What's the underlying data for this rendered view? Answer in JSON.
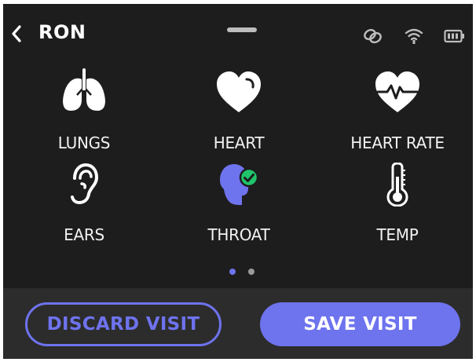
{
  "header": {
    "title": "RON",
    "icons": [
      "back-chevron-icon",
      "link-icon",
      "wifi-icon",
      "battery-icon"
    ]
  },
  "exam_items": [
    {
      "label": "LUNGS",
      "icon": "lungs-icon"
    },
    {
      "label": "HEART",
      "icon": "heart-icon"
    },
    {
      "label": "HEART RATE",
      "icon": "heart-rate-icon"
    },
    {
      "label": "EARS",
      "icon": "ear-icon"
    },
    {
      "label": "THROAT",
      "icon": "throat-icon",
      "completed": true
    },
    {
      "label": "TEMP",
      "icon": "thermometer-icon"
    }
  ],
  "pagination": {
    "pages": 2,
    "current": 1
  },
  "footer": {
    "discard_label": "DISCARD VISIT",
    "save_label": "SAVE VISIT"
  },
  "colors": {
    "background": "#1d1d1d",
    "footer_bg": "#2c2c2c",
    "accent": "#6e73ee",
    "check_green": "#1fc46b",
    "dot_inactive": "#9a9a9a"
  }
}
